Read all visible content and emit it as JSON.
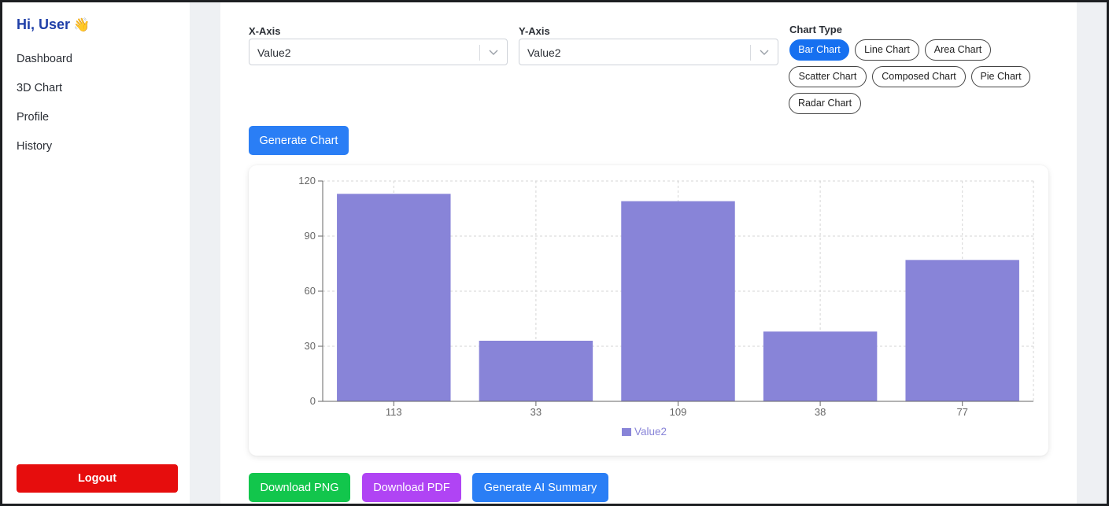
{
  "sidebar": {
    "greeting": "Hi, User",
    "greeting_emoji": "👋",
    "items": [
      {
        "label": "Dashboard"
      },
      {
        "label": "3D Chart"
      },
      {
        "label": "Profile"
      },
      {
        "label": "History"
      }
    ],
    "logout_label": "Logout"
  },
  "controls": {
    "x_axis_label": "X-Axis",
    "x_axis_value": "Value2",
    "y_axis_label": "Y-Axis",
    "y_axis_value": "Value2",
    "chart_type_label": "Chart Type",
    "chart_types": [
      {
        "label": "Bar Chart",
        "active": true
      },
      {
        "label": "Line Chart",
        "active": false
      },
      {
        "label": "Area Chart",
        "active": false
      },
      {
        "label": "Scatter Chart",
        "active": false
      },
      {
        "label": "Composed Chart",
        "active": false
      },
      {
        "label": "Pie Chart",
        "active": false
      },
      {
        "label": "Radar Chart",
        "active": false
      }
    ],
    "generate_label": "Generate Chart"
  },
  "actions": {
    "download_png": "Download PNG",
    "download_pdf": "Download PDF",
    "ai_summary": "Generate AI Summary"
  },
  "colors": {
    "bar": "#8884d8",
    "primary": "#1670f0",
    "download_png": "#12c64c",
    "download_pdf": "#b044f4",
    "ai_summary": "#2a7ef5",
    "logout": "#e60d0d"
  },
  "chart_data": {
    "type": "bar",
    "categories": [
      "113",
      "33",
      "109",
      "38",
      "77"
    ],
    "series": [
      {
        "name": "Value2",
        "values": [
          113,
          33,
          109,
          38,
          77
        ]
      }
    ],
    "ylim": [
      0,
      120
    ],
    "yticks": [
      "0",
      "30",
      "60",
      "90",
      "120"
    ],
    "grid": true,
    "legend": "bottom"
  }
}
